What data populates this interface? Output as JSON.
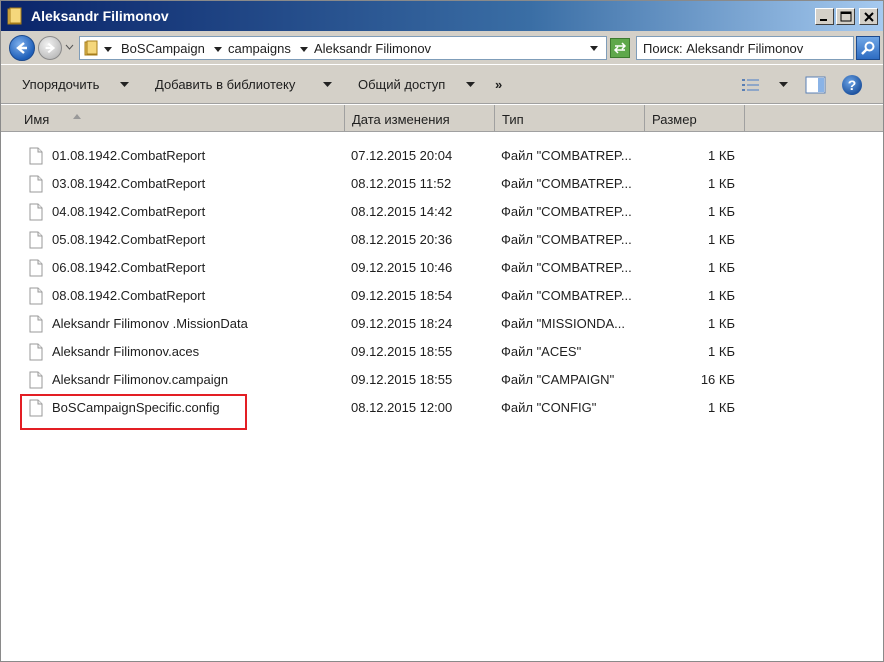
{
  "window": {
    "title": "Aleksandr Filimonov"
  },
  "address": {
    "crumbs": [
      "BoSCampaign",
      "campaigns",
      "Aleksandr Filimonov"
    ]
  },
  "search": {
    "value": "Поиск: Aleksandr Filimonov"
  },
  "commands": {
    "organize": "Упорядочить",
    "add_library": "Добавить в библиотеку",
    "share": "Общий доступ",
    "more": "»",
    "help": "?"
  },
  "columns": {
    "name": "Имя",
    "date": "Дата изменения",
    "type": "Тип",
    "size": "Размер"
  },
  "files": [
    {
      "name": "01.08.1942.CombatReport",
      "date": "07.12.2015 20:04",
      "type": "Файл \"COMBATREP...",
      "size": "1 КБ"
    },
    {
      "name": "03.08.1942.CombatReport",
      "date": "08.12.2015 11:52",
      "type": "Файл \"COMBATREP...",
      "size": "1 КБ"
    },
    {
      "name": "04.08.1942.CombatReport",
      "date": "08.12.2015 14:42",
      "type": "Файл \"COMBATREP...",
      "size": "1 КБ"
    },
    {
      "name": "05.08.1942.CombatReport",
      "date": "08.12.2015 20:36",
      "type": "Файл \"COMBATREP...",
      "size": "1 КБ"
    },
    {
      "name": "06.08.1942.CombatReport",
      "date": "09.12.2015 10:46",
      "type": "Файл \"COMBATREP...",
      "size": "1 КБ"
    },
    {
      "name": "08.08.1942.CombatReport",
      "date": "09.12.2015 18:54",
      "type": "Файл \"COMBATREP...",
      "size": "1 КБ"
    },
    {
      "name": "Aleksandr Filimonov .MissionData",
      "date": "09.12.2015 18:24",
      "type": "Файл \"MISSIONDA...",
      "size": "1 КБ"
    },
    {
      "name": "Aleksandr Filimonov.aces",
      "date": "09.12.2015 18:55",
      "type": "Файл \"ACES\"",
      "size": "1 КБ"
    },
    {
      "name": "Aleksandr Filimonov.campaign",
      "date": "09.12.2015 18:55",
      "type": "Файл \"CAMPAIGN\"",
      "size": "16 КБ"
    },
    {
      "name": "BoSCampaignSpecific.config",
      "date": "08.12.2015 12:00",
      "type": "Файл \"CONFIG\"",
      "size": "1 КБ"
    }
  ],
  "colors": {
    "highlight": "#e31e24",
    "titlebar": "#0a246a"
  }
}
